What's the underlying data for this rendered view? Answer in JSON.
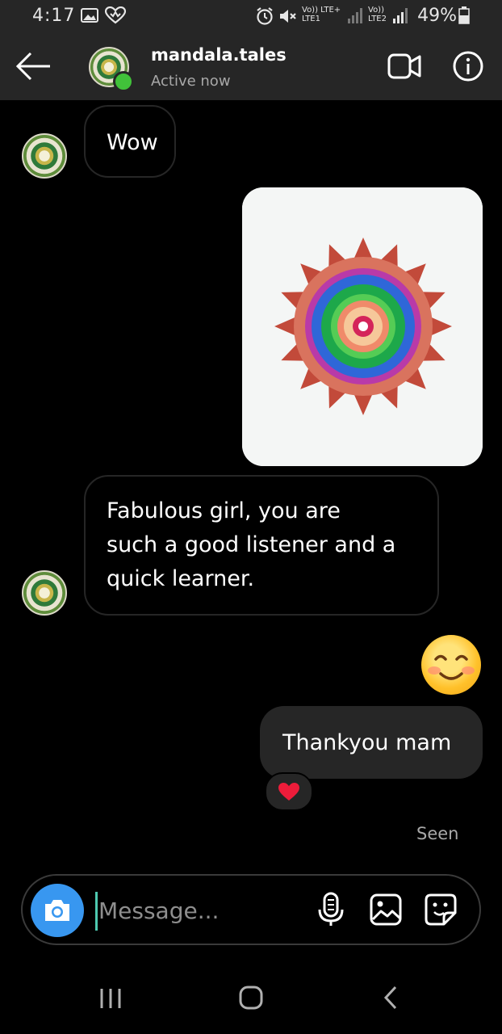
{
  "status_bar": {
    "time": "4:17",
    "sim1": "Vo)) LTE+",
    "sim1_sub": "LTE1",
    "sim2": "Vo))",
    "sim2_sub": "LTE2",
    "battery": "49%",
    "icons": [
      "gallery-icon",
      "heart-notification-icon",
      "alarm-icon",
      "mute-icon",
      "signal-icon",
      "battery-icon"
    ]
  },
  "header": {
    "back_icon": "arrow-left-icon",
    "username": "mandala.tales",
    "status": "Active now",
    "video_icon": "video-call-icon",
    "info_icon": "info-icon",
    "online_color": "#41c23a"
  },
  "messages": [
    {
      "from": "them",
      "text": "Wow"
    },
    {
      "from": "me",
      "type": "image",
      "description_icon": "mandala-photo"
    },
    {
      "from": "them",
      "lines": [
        "Fabulous girl, you are",
        "such a good listener and a",
        "quick learner."
      ]
    },
    {
      "from": "me",
      "type": "emoji",
      "text": "😊"
    },
    {
      "from": "me",
      "text": "Thankyou mam",
      "reaction": "❤️"
    }
  ],
  "seen_label": "Seen",
  "composer": {
    "placeholder": "Message...",
    "camera_icon": "camera-icon",
    "mic_icon": "microphone-icon",
    "gallery_icon": "image-icon",
    "sticker_icon": "sticker-icon",
    "accent": "#3897f0"
  },
  "nav": {
    "recents_icon": "recents-icon",
    "home_icon": "home-icon",
    "back_icon": "back-chevron-icon"
  }
}
